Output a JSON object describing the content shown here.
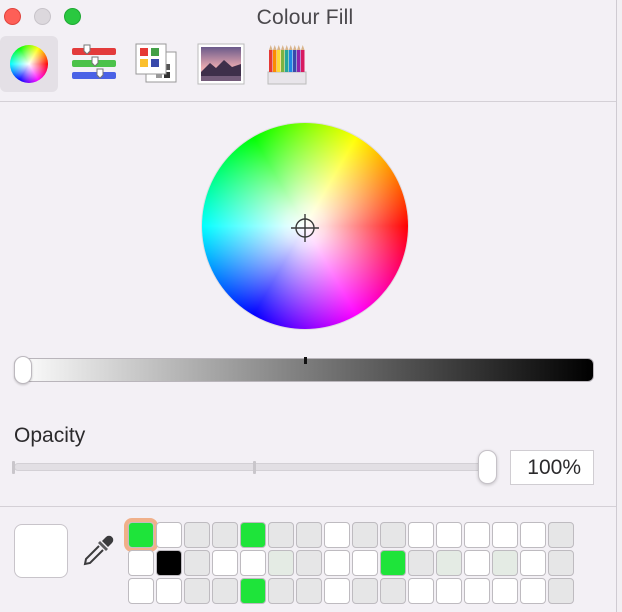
{
  "window": {
    "title": "Colour Fill"
  },
  "toolbar": {
    "tools": [
      {
        "name": "Colour Wheel",
        "icon": "color-wheel-icon",
        "selected": true
      },
      {
        "name": "Colour Sliders",
        "icon": "sliders-icon",
        "selected": false
      },
      {
        "name": "Colour Palettes",
        "icon": "palettes-icon",
        "selected": false
      },
      {
        "name": "Image Palettes",
        "icon": "image-palette-icon",
        "selected": false
      },
      {
        "name": "Pencils",
        "icon": "pencils-icon",
        "selected": false
      }
    ]
  },
  "brightness": {
    "value_fraction": 0.0
  },
  "opacity": {
    "label": "Opacity",
    "value": "100%",
    "value_fraction": 1.0
  },
  "current_color": "#ffffff",
  "swatches": {
    "rows": [
      [
        "#1ee43a",
        "#ffffff",
        "#e6e6e7",
        "#e6e6e7",
        "#1ee43a",
        "#e6e6e7",
        "#e6e6e7",
        "#ffffff",
        "#e6e6e7",
        "#e6e6e7",
        "#ffffff",
        "#ffffff",
        "#ffffff",
        "#ffffff",
        "#ffffff",
        "#e6e6e7"
      ],
      [
        "#ffffff",
        "#000000",
        "#e6e6e7",
        "#ffffff",
        "#ffffff",
        "#e4ebe4",
        "#e6e6e7",
        "#ffffff",
        "#ffffff",
        "#1ee43a",
        "#e6e6e7",
        "#e4ebe4",
        "#ffffff",
        "#e4ebe4",
        "#ffffff",
        "#e6e6e7"
      ],
      [
        "#ffffff",
        "#ffffff",
        "#e6e6e7",
        "#e6e6e7",
        "#1ee43a",
        "#e6e6e7",
        "#e6e6e7",
        "#ffffff",
        "#e6e6e7",
        "#e6e6e7",
        "#ffffff",
        "#ffffff",
        "#ffffff",
        "#ffffff",
        "#ffffff",
        "#e6e6e7"
      ]
    ],
    "selected_row": 0,
    "selected_col": 0
  }
}
